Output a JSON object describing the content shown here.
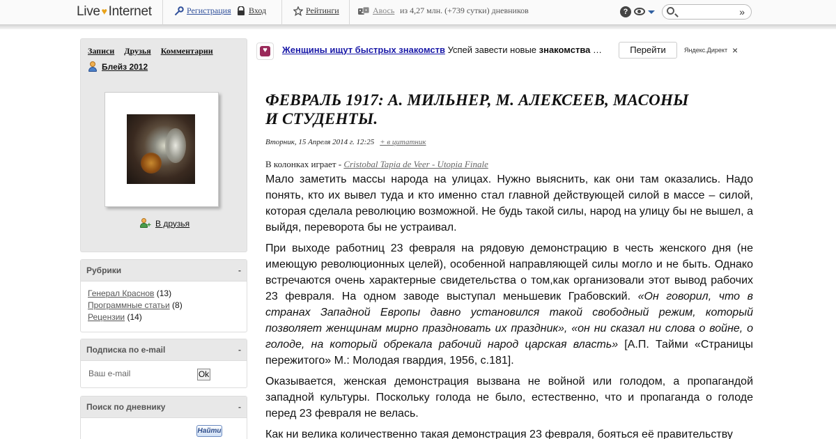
{
  "topbar": {
    "logo_left": "Live",
    "logo_right": "Internet",
    "register": "Регистрация",
    "login": "Вход",
    "ratings": "Рейтинги",
    "avos": "Авось",
    "stats": "из 4,27 млн. (+739 сутки) дневников",
    "help": "?",
    "search_go": "»"
  },
  "sidebar": {
    "nav": [
      "Записи",
      "Друзья",
      "Комментарии"
    ],
    "username": "Блейз 2012",
    "add_friend": "В друзья",
    "rubrics": {
      "title": "Рубрики",
      "toggle": "-",
      "items": [
        {
          "label": "Генерал Краснов",
          "count": "(13)"
        },
        {
          "label": "Программные статьи",
          "count": "(8)"
        },
        {
          "label": "Рецензии",
          "count": "(14)"
        }
      ]
    },
    "email": {
      "title": "Подписка по e-mail",
      "toggle": "-",
      "placeholder": "Ваш e-mail",
      "ok": "Ok"
    },
    "search": {
      "title": "Поиск по дневнику",
      "toggle": "-",
      "button": "Найти"
    }
  },
  "ad": {
    "title": "Женщины ищут быстрых знакомств",
    "text_before": " Успей завести новые ",
    "text_bold": "знакомства",
    "text_after": " …",
    "button": "Перейти",
    "source": "Яндекс.Директ",
    "close": "×"
  },
  "post": {
    "title": "ФЕВРАЛЬ 1917: А. МИЛЬНЕР, М. АЛЕКСЕЕВ, МАСОНЫ И СТУДЕНТЫ.",
    "date": "Вторник, 15 Апреля 2014 г. 12:25",
    "quote_link": "+ в цитатник",
    "music_prefix": "В колонках играет - ",
    "music_track": "Cristobal Tapia de Veer - Utopia Finale",
    "p1": "Мало заметить массы народа на улицах. Нужно выяснить, как они там оказались. Надо понять, кто их вывел туда и кто именно стал главной действующей силой в массе – силой, которая сделала революцию возможной. Не будь такой силы, народ на улицу бы не вышел, а выйдя, переворота бы не устраивал.",
    "p2_start": "При выходе работниц 23 февраля на рядовую демонстрацию в честь женского дня (не имеющую революционных целей), особенной направляющей силы могло и не быть. Однако встречаются очень характерные свидетельства о том,как организовали этот вывод рабочих 23 февраля. На одном заводе выступал меньшевик Грабовский. ",
    "p2_quote": "«Он говорил, что в странах Западной Европы давно установился такой свободный режим, который позволяет женщинам мирно праздновать их праздник», «он ни сказал ни слова о войне, о голоде, на который обрекала рабочий народ царская власть»",
    "p2_end": " [А.П. Тайми «Страницы пережитого» М.: Молодая гвардия, 1956, с.181].",
    "p3": "Оказывается, женская демонстрация вызвана не войной или голодом, а пропагандой западной культуры. Поскольку голода не было, естественно, что и пропаганда о голоде перед 23 февраля не велась.",
    "p4": "Как ни велика количественно такая демонстрация 23 февраля, бояться её правительству"
  }
}
